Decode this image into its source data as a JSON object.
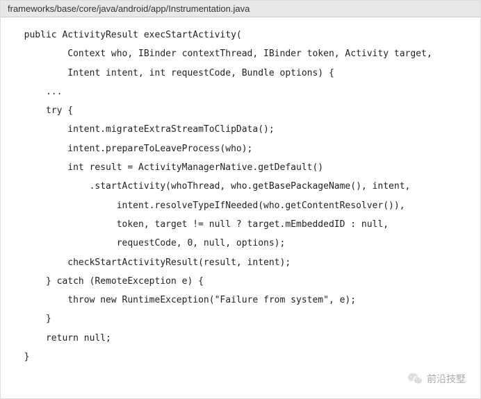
{
  "header": {
    "filepath": "frameworks/base/core/java/android/app/Instrumentation.java"
  },
  "code": {
    "lines": [
      "  public ActivityResult execStartActivity(",
      "          Context who, IBinder contextThread, IBinder token, Activity target,",
      "          Intent intent, int requestCode, Bundle options) {",
      "      ...",
      "      try {",
      "          intent.migrateExtraStreamToClipData();",
      "          intent.prepareToLeaveProcess(who);",
      "          int result = ActivityManagerNative.getDefault()",
      "              .startActivity(whoThread, who.getBasePackageName(), intent,",
      "                   intent.resolveTypeIfNeeded(who.getContentResolver()),",
      "                   token, target != null ? target.mEmbeddedID : null,",
      "                   requestCode, 0, null, options);",
      "          checkStartActivityResult(result, intent);",
      "      } catch (RemoteException e) {",
      "          throw new RuntimeException(\"Failure from system\", e);",
      "      }",
      "      return null;",
      "  }"
    ]
  },
  "watermark": {
    "text": "前沿技墅"
  }
}
